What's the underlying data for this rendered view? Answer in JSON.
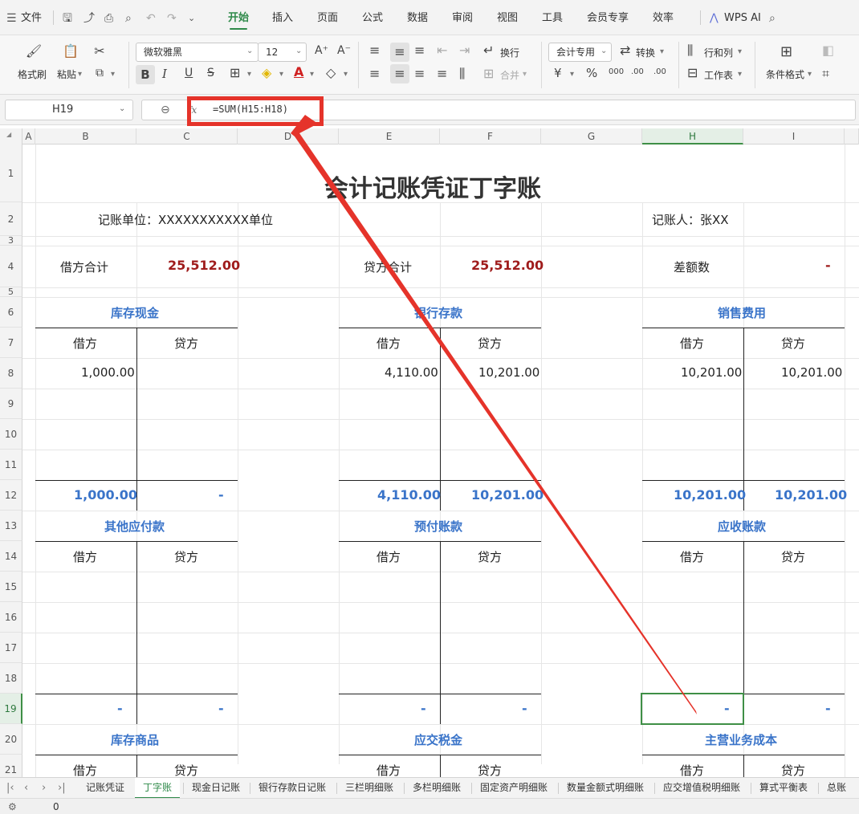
{
  "menubar": {
    "file_label": "文件",
    "tabs": [
      "开始",
      "插入",
      "页面",
      "公式",
      "数据",
      "审阅",
      "视图",
      "工具",
      "会员专享",
      "效率"
    ],
    "wps_ai_label": "WPS AI"
  },
  "ribbon": {
    "format_painter": "格式刷",
    "paste": "粘贴",
    "font_name": "微软雅黑",
    "font_size": "12",
    "bold": "B",
    "italic": "I",
    "underline": "U",
    "strike": "S",
    "wrap": "换行",
    "merge": "合并",
    "number_format": "会计专用",
    "convert": "转换",
    "rowcol": "行和列",
    "worksheet": "工作表",
    "cond_format": "条件格式",
    "currency": "¥",
    "percent": "%",
    "thousand": "000",
    "dec_inc": ".00",
    "dec_dec": ".00"
  },
  "formula_bar": {
    "cell_ref": "H19",
    "fx": "fx",
    "formula": "=SUM(H15:H18)"
  },
  "columns": [
    "A",
    "B",
    "C",
    "D",
    "E",
    "F",
    "G",
    "H",
    "I"
  ],
  "rows": [
    "1",
    "2",
    "3",
    "4",
    "5",
    "6",
    "7",
    "8",
    "9",
    "10",
    "11",
    "12",
    "13",
    "14",
    "15",
    "16",
    "17",
    "18",
    "19",
    "20",
    "21"
  ],
  "cells": {
    "title": "会计记账凭证丁字账",
    "unit": "记账单位：XXXXXXXXXXX单位",
    "bookkeeper": "记账人：张XX",
    "debit_total_label": "借方合计",
    "debit_total_value": "25,512.00",
    "credit_total_label": "贷方合计",
    "credit_total_value": "25,512.00",
    "diff_label": "差额数",
    "diff_value": "-",
    "debit": "借方",
    "credit": "贷方",
    "accounts": {
      "cash": {
        "name": "库存现金",
        "r8d": "1,000.00",
        "totd": "1,000.00",
        "totc": "-"
      },
      "bank": {
        "name": "银行存款",
        "r8d": "4,110.00",
        "r8c": "10,201.00",
        "totd": "4,110.00",
        "totc": "10,201.00"
      },
      "sales": {
        "name": "销售费用",
        "r8d": "10,201.00",
        "r8c": "10,201.00",
        "totd": "10,201.00",
        "totc": "10,201.00"
      },
      "other_payable": {
        "name": "其他应付款",
        "totd": "-",
        "totc": "-"
      },
      "prepaid": {
        "name": "预付账款",
        "totd": "-",
        "totc": "-"
      },
      "receivable": {
        "name": "应收账款",
        "totd": "-",
        "totc": "-"
      },
      "inventory": {
        "name": "库存商品"
      },
      "tax": {
        "name": "应交税金"
      },
      "cost": {
        "name": "主营业务成本"
      }
    }
  },
  "sheet_tabs": [
    "记账凭证",
    "丁字账",
    "现金日记账",
    "银行存款日记账",
    "三栏明细账",
    "多栏明细账",
    "固定资产明细账",
    "数量金额式明细账",
    "应交增值税明细账",
    "算式平衡表",
    "总账"
  ],
  "status": {
    "value": "0"
  },
  "annotation": {
    "color": "#e5332a"
  }
}
